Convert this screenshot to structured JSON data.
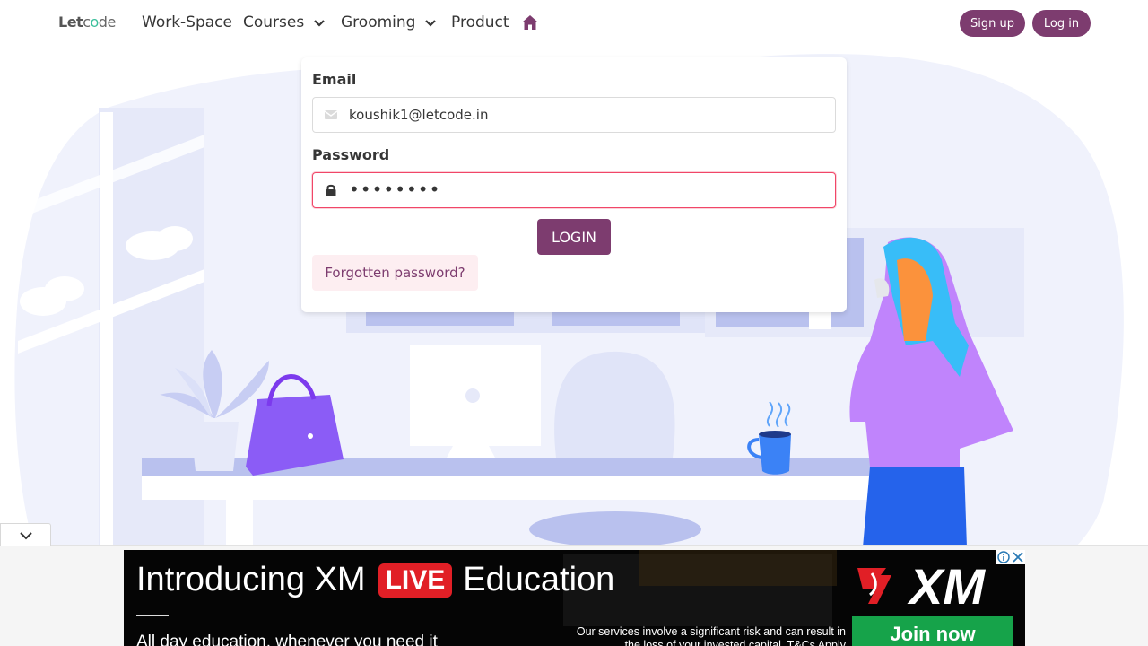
{
  "nav": {
    "logo_prefix": "Let",
    "logo_c": "c",
    "logo_o": "o",
    "logo_suffix": "de",
    "items": [
      {
        "label": "Work-Space"
      },
      {
        "label": "Courses"
      },
      {
        "label": "Grooming"
      },
      {
        "label": "Product"
      }
    ],
    "home_icon": "home-icon",
    "signup_label": "Sign up",
    "login_label": "Log in"
  },
  "login_form": {
    "email_label": "Email",
    "email_value": "koushik1@letcode.in",
    "email_icon": "envelope-icon",
    "password_label": "Password",
    "password_value": "••••••••",
    "password_icon": "lock-icon",
    "submit_label": "LOGIN",
    "forgot_label": "Forgotten password?"
  },
  "ad": {
    "headline_pre": "Introducing XM",
    "headline_live": "LIVE",
    "headline_post": "Education",
    "subline": "All day education, whenever you need it",
    "risk_text": "Our services involve a significant risk and can result in the loss of your invested capital. T&Cs Apply",
    "brand": "XM",
    "cta_label": "Join now"
  },
  "colors": {
    "brand": "#7d3c6f",
    "danger": "#f14668",
    "ad_bg": "#050505",
    "live_red": "#e11f26",
    "cta_green": "#16a34a",
    "illustration_blue": "#eef0fb"
  }
}
